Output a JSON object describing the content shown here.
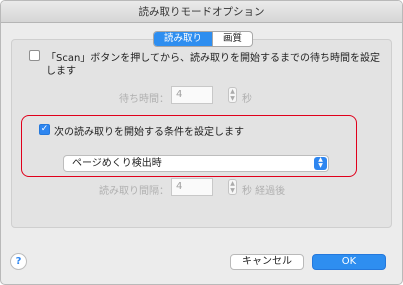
{
  "window": {
    "title": "読み取りモードオプション"
  },
  "tabs": [
    {
      "label": "読み取り",
      "active": true
    },
    {
      "label": "画質",
      "active": false
    }
  ],
  "wait_option": {
    "checked": false,
    "label_line1": "「Scan」ボタンを押してから、読み取りを開始するまでの待ち時間を設定",
    "label_line2": "します",
    "field_label": "待ち時間：",
    "value": "4",
    "unit": "秒"
  },
  "condition_option": {
    "checked": true,
    "label": "次の読み取りを開始する条件を設定します",
    "select_value": "ページめくり検出時",
    "interval_label": "読み取り間隔：",
    "interval_value": "4",
    "interval_unit": "秒 経過後"
  },
  "footer": {
    "help": "?",
    "cancel_label": "キャンセル",
    "ok_label": "OK"
  },
  "colors": {
    "accent": "#2e8ef0",
    "highlight": "#e0001b"
  }
}
